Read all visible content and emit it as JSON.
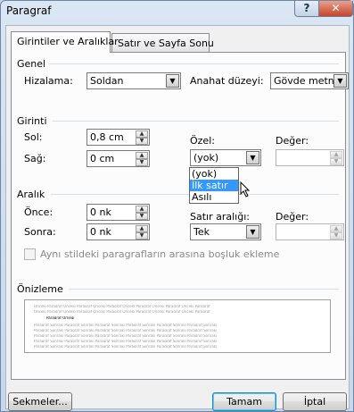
{
  "window": {
    "title": "Paragraf",
    "help": "?",
    "close": "✕"
  },
  "tabs": [
    {
      "label": "Girintiler ve Aralıklar",
      "active": true
    },
    {
      "label": "Satır ve Sayfa Sonu",
      "active": false
    }
  ],
  "genel": {
    "heading": "Genel",
    "alignment_label": "Hizalama:",
    "alignment_value": "Soldan",
    "outline_label": "Anahat düzeyi:",
    "outline_value": "Gövde metni"
  },
  "girinti": {
    "heading": "Girinti",
    "left_label": "Sol:",
    "left_value": "0,8 cm",
    "right_label": "Sağ:",
    "right_value": "0 cm",
    "special_label": "Özel:",
    "special_value": "(yok)",
    "special_options": [
      "(yok)",
      "İlk satır",
      "Asılı"
    ],
    "by_label": "Değer:",
    "by_value": ""
  },
  "aralik": {
    "heading": "Aralık",
    "before_label": "Önce:",
    "before_value": "0 nk",
    "after_label": "Sonra:",
    "after_value": "0 nk",
    "line_spacing_label": "Satır aralığı:",
    "line_spacing_value": "Tek",
    "at_label": "Değer:",
    "at_value": "",
    "no_space_same_style": "Aynı stildeki paragrafların arasına boşluk ekleme"
  },
  "preview": {
    "heading": "Önizleme",
    "prev_text": "Önceki Paragraf Önceki Paragraf Önceki Paragraf Önceki Paragraf Önceki Paragraf Önceki Paragraf",
    "current_text": "Paragraf Örneği",
    "next_text": "Paragraf Sonraki Paragraf Sonraki Paragraf Sonraki Paragraf Sonraki Paragraf Sonraki Paragraf Sonraki"
  },
  "buttons": {
    "tabs": "Sekmeler...",
    "ok": "Tamam",
    "cancel": "İptal"
  }
}
